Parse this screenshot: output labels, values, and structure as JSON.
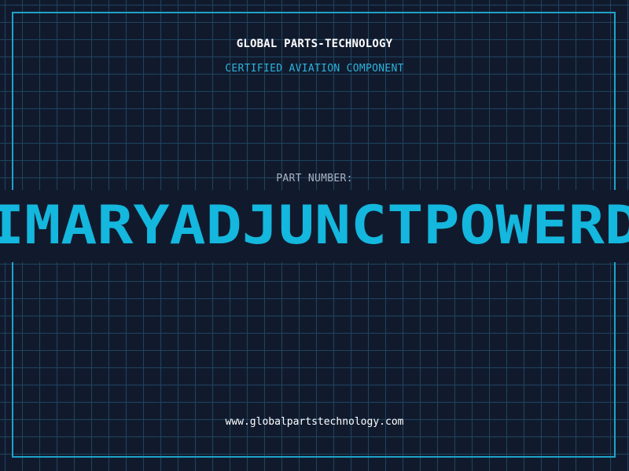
{
  "header": {
    "company": "GLOBAL PARTS-TECHNOLOGY",
    "subtitle": "CERTIFIED AVIATION COMPONENT"
  },
  "part": {
    "label": "PART NUMBER:",
    "number": "IMARYADJUNCTPOWERD"
  },
  "footer": {
    "website": "www.globalpartstechnology.com"
  },
  "colors": {
    "background": "#111a2d",
    "grid": "#1e4460",
    "accent": "#14b7dd",
    "frame": "#1fa3c9"
  }
}
